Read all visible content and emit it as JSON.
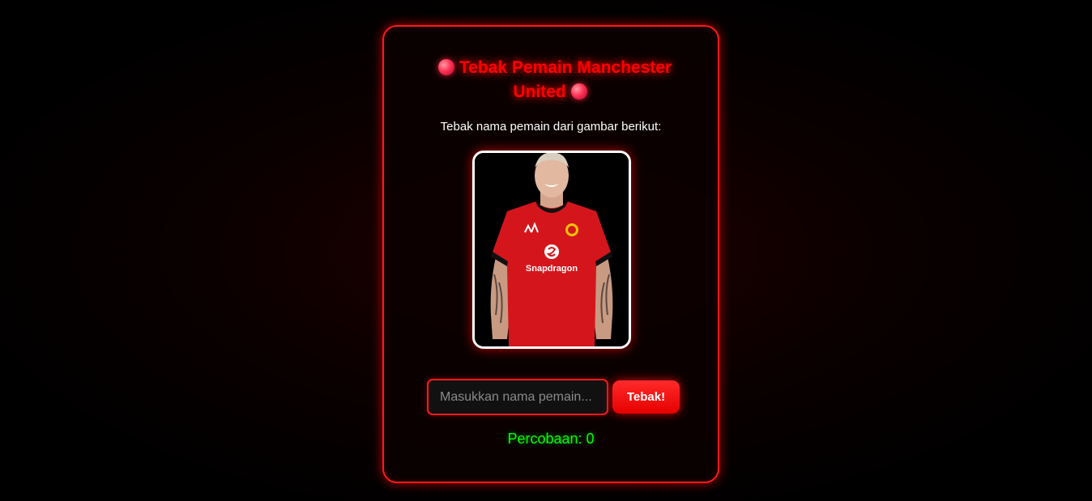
{
  "game": {
    "title": "Tebak Pemain Manchester United",
    "title_icon": "red-ball-icon",
    "instruction": "Tebak nama pemain dari gambar berikut:",
    "player_image": {
      "description_icon": "player-photo",
      "shirt_sponsor": "Snapdragon"
    },
    "input": {
      "placeholder": "Masukkan nama pemain...",
      "value": ""
    },
    "submit_label": "Tebak!",
    "attempts_label": "Percobaan: 0"
  },
  "colors": {
    "accent": "#ff0000",
    "background": "#000000",
    "attempts_text": "#00ff00",
    "button": "#ff1a1a"
  }
}
